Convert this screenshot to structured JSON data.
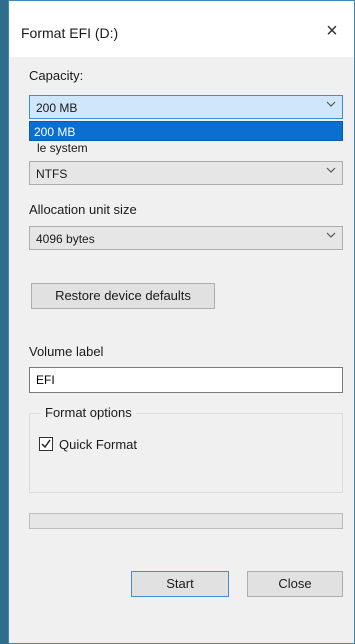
{
  "window": {
    "title": "Format EFI (D:)",
    "close_glyph": "×"
  },
  "capacity": {
    "label": "Capacity:",
    "value": "200 MB",
    "options": [
      "200 MB"
    ]
  },
  "file_system": {
    "label_partial": "le system",
    "value": "NTFS"
  },
  "allocation": {
    "label": "Allocation unit size",
    "value": "4096 bytes"
  },
  "restore_button": "Restore device defaults",
  "volume": {
    "label": "Volume label",
    "value": "EFI"
  },
  "format_options": {
    "legend": "Format options",
    "quick_format_label": "Quick Format",
    "quick_format_checked": true
  },
  "progress": {
    "fraction": 0
  },
  "buttons": {
    "start": "Start",
    "close": "Close"
  },
  "icons": {
    "dropdown": "chevron-down-icon",
    "close": "close-icon",
    "check": "check-icon"
  },
  "colors": {
    "selection": "#0a6fd1",
    "focus_border": "#3c8fd8",
    "progress": "#06b025"
  }
}
